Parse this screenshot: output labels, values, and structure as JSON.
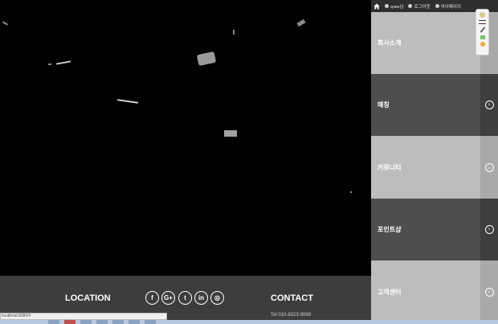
{
  "topbar": {
    "home_icon": "home-icon",
    "user_label": "qwe님",
    "logout_label": "로그아웃",
    "mypage_label": "마이페이지"
  },
  "menu": [
    {
      "label": "회사소개",
      "tone": "light",
      "icon": "chevron-right-circle-icon"
    },
    {
      "label": "매칭",
      "tone": "dark",
      "icon": "chevron-right-circle-icon"
    },
    {
      "label": "커뮤니티",
      "tone": "light",
      "icon": "chevron-down-circle-icon"
    },
    {
      "label": "포인트샵",
      "tone": "dark",
      "icon": "chevron-right-circle-icon"
    },
    {
      "label": "고객센터",
      "tone": "light",
      "icon": "chevron-right-circle-icon"
    }
  ],
  "footer": {
    "location_title": "LOCATION",
    "contact_title": "CONTACT",
    "tel": "Tel 010-8323-9068",
    "social": [
      "f",
      "G+",
      "t",
      "in",
      "◎"
    ]
  },
  "status_bar": {
    "url": "localhost:8080/#"
  },
  "colors": {
    "sidebar_light": "#bdbdbd",
    "sidebar_dark": "#4e4e4e",
    "footer_bg": "#3d3d3d",
    "canvas_bg": "#000000"
  }
}
